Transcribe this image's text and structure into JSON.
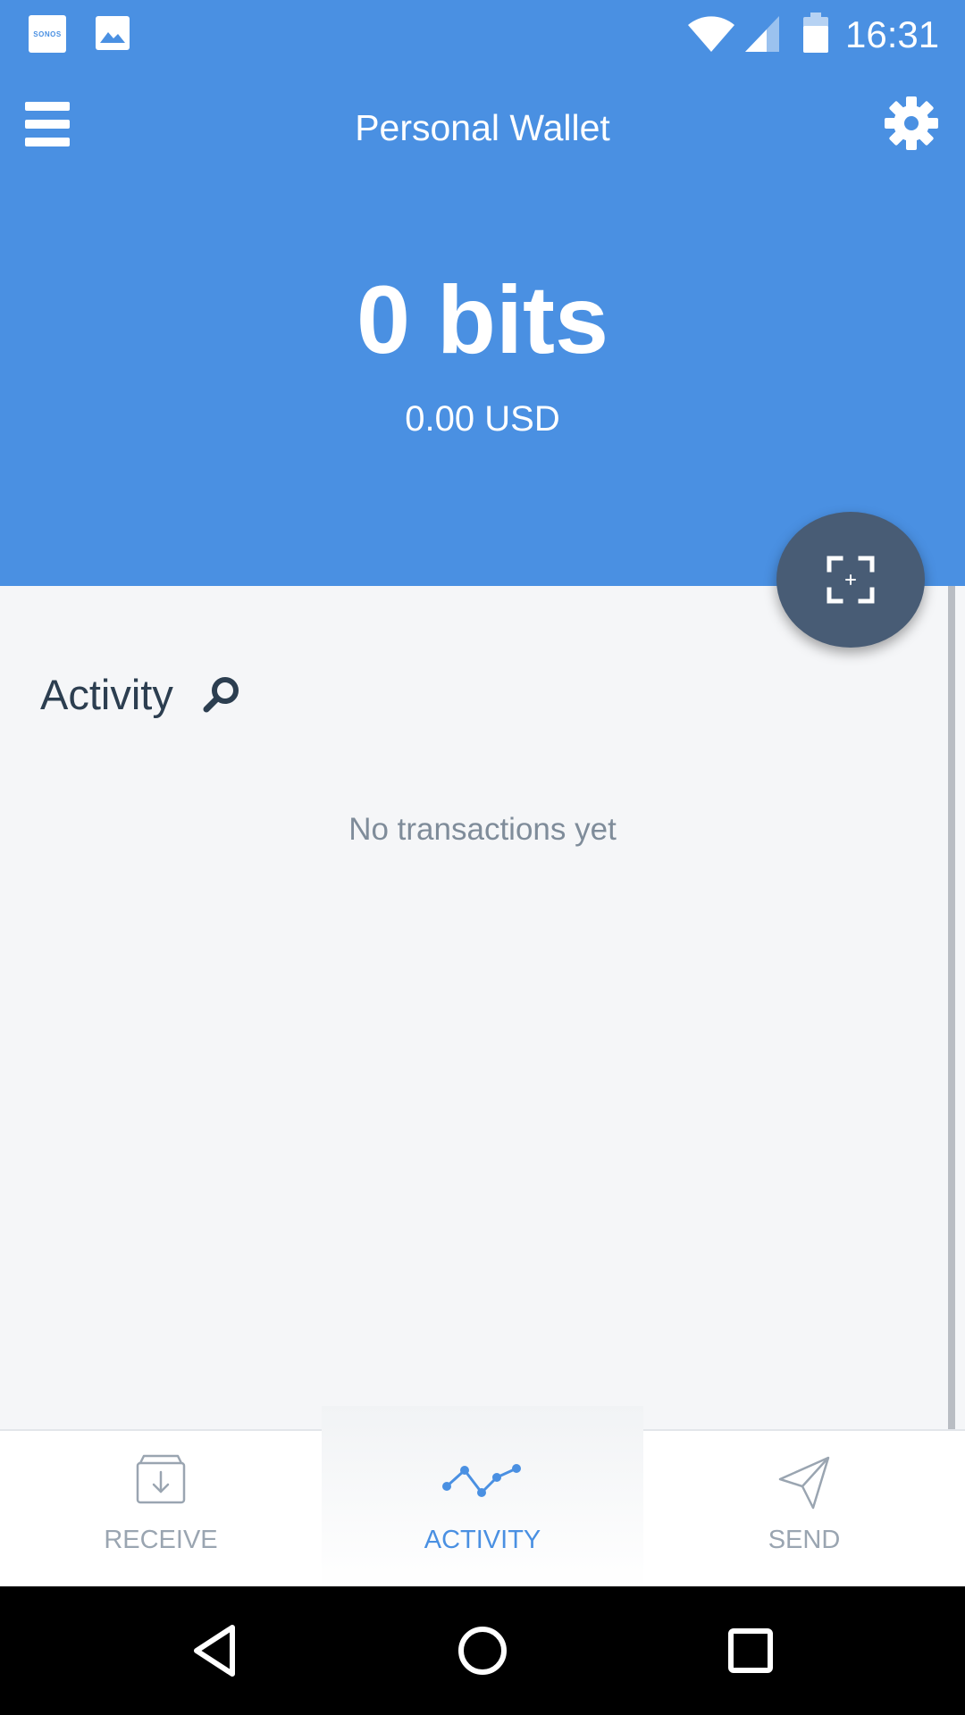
{
  "colors": {
    "header_bg": "#4a90e2",
    "fab_bg": "#485c75",
    "active_tab": "#4a90e2",
    "inactive_tab": "#9aa5b1",
    "content_bg": "#f5f6f8"
  },
  "status_bar": {
    "time": "16:31",
    "notifications": [
      {
        "icon": "sonos-icon",
        "text": "SONOS"
      },
      {
        "icon": "image-icon"
      }
    ],
    "icons": [
      "wifi-icon",
      "signal-icon",
      "battery-icon"
    ]
  },
  "header": {
    "title": "Personal Wallet",
    "menu_icon": "hamburger-menu-icon",
    "settings_icon": "gear-icon"
  },
  "balance": {
    "amount": "0 bits",
    "fiat": "0.00 USD"
  },
  "fab": {
    "icon": "scan-qr-icon"
  },
  "activity": {
    "heading": "Activity",
    "search_icon": "search-icon",
    "empty_message": "No transactions yet"
  },
  "tabs": [
    {
      "label": "RECEIVE",
      "icon": "receive-tray-icon",
      "active": false
    },
    {
      "label": "ACTIVITY",
      "icon": "activity-graph-icon",
      "active": true
    },
    {
      "label": "SEND",
      "icon": "paper-plane-icon",
      "active": false
    }
  ],
  "nav_bar": {
    "icons": [
      "back-triangle-icon",
      "home-circle-icon",
      "recents-square-icon"
    ]
  }
}
